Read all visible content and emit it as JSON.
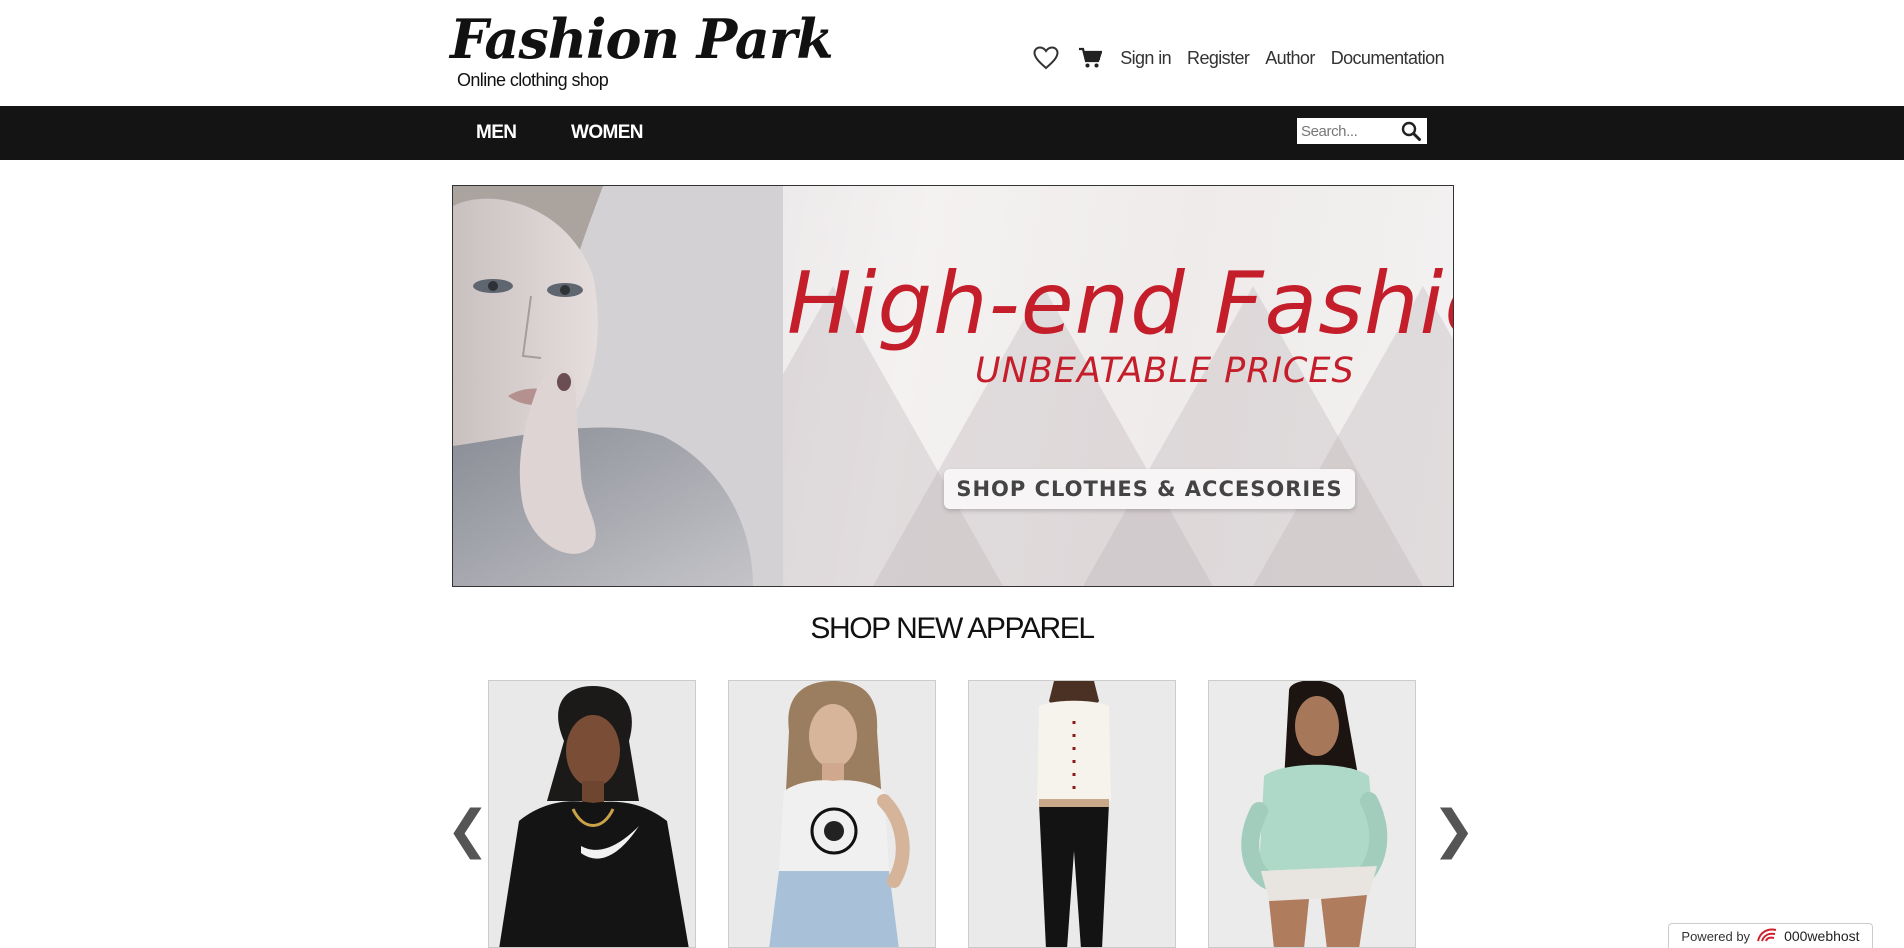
{
  "header": {
    "logo_title": "Fashion Park",
    "tagline": "Online clothing shop",
    "nav": {
      "wishlist_icon": "heart-outline-icon",
      "cart_icon": "shopping-cart-icon",
      "sign_in": "Sign in",
      "register": "Register",
      "author": "Author",
      "documentation": "Documentation"
    }
  },
  "category_bar": {
    "items": [
      "MEN",
      "WOMEN"
    ],
    "search_placeholder": "Search...",
    "search_icon": "magnifier-icon"
  },
  "hero": {
    "title": "High-end Fashion",
    "subtitle": "UNBEATABLE PRICES",
    "cta": "SHOP CLOTHES & ACCESORIES"
  },
  "section": {
    "title": "SHOP NEW APPAREL"
  },
  "carousel": {
    "prev_glyph": "❮",
    "next_glyph": "❯",
    "products": [
      {
        "icon": "model-black-nike-top"
      },
      {
        "icon": "model-white-graphic-tank"
      },
      {
        "icon": "model-white-top-black-jeans"
      },
      {
        "icon": "model-mint-hoodie"
      }
    ]
  },
  "footer_badge": {
    "prefix": "Powered by",
    "brand": "000webhost"
  },
  "colors": {
    "category_bar_bg": "#141414",
    "hero_red": "#c41e2b"
  }
}
